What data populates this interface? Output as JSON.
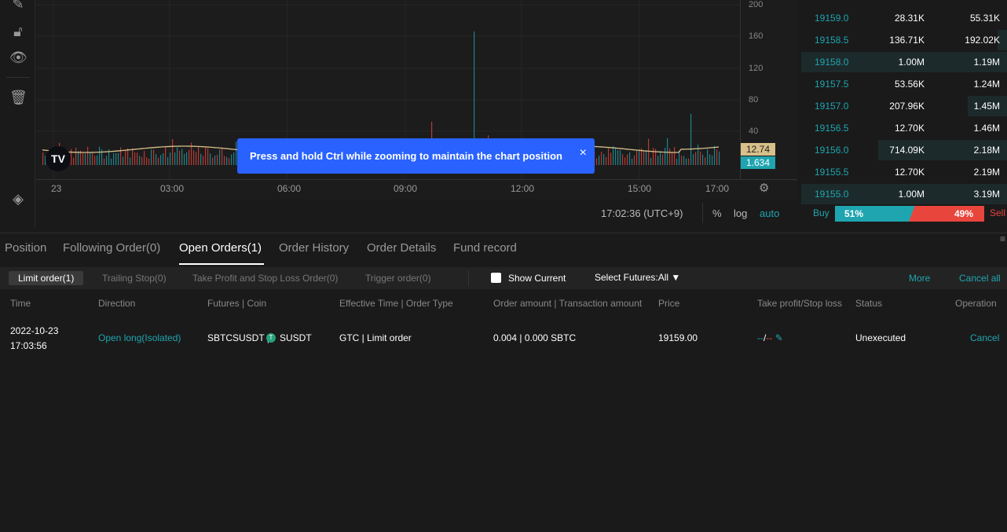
{
  "chart": {
    "price_ticks": [
      "200",
      "160",
      "120",
      "80",
      "40"
    ],
    "time_ticks": [
      "23",
      "03:00",
      "06:00",
      "09:00",
      "12:00",
      "15:00",
      "17:00"
    ],
    "badge_ma": "12.74",
    "badge_vol": "1.634",
    "badge_ma_color": "#d7c08a",
    "badge_vol_color": "#1fa5b0",
    "clock": "17:02:36 (UTC+9)",
    "pct_label": "%",
    "log_label": "log",
    "auto_label": "auto",
    "logo": "TV"
  },
  "toast": {
    "message": "Press and hold Ctrl while zooming to maintain the chart position",
    "close": "×"
  },
  "orderbook": {
    "rows": [
      {
        "price": "19159.0",
        "qty": "28.31K",
        "total": "55.31K"
      },
      {
        "price": "19158.5",
        "qty": "136.71K",
        "total": "192.02K"
      },
      {
        "price": "19158.0",
        "qty": "1.00M",
        "total": "1.19M"
      },
      {
        "price": "19157.5",
        "qty": "53.56K",
        "total": "1.24M"
      },
      {
        "price": "19157.0",
        "qty": "207.96K",
        "total": "1.45M"
      },
      {
        "price": "19156.5",
        "qty": "12.70K",
        "total": "1.46M"
      },
      {
        "price": "19156.0",
        "qty": "714.09K",
        "total": "2.18M"
      },
      {
        "price": "19155.5",
        "qty": "12.70K",
        "total": "2.19M"
      },
      {
        "price": "19155.0",
        "qty": "1.00M",
        "total": "3.19M"
      }
    ],
    "buy_label": "Buy",
    "buy_pct": "51%",
    "sell_pct": "49%",
    "sell_label": "Sell",
    "buy_fraction": 0.51,
    "buy_color": "#1fa5b0",
    "sell_color": "#e8453c"
  },
  "tabs": [
    "Position",
    "Following Order(0)",
    "Open Orders(1)",
    "Order History",
    "Order Details",
    "Fund record"
  ],
  "subtabs": [
    "Limit order(1)",
    "Trailing Stop(0)",
    "Take Profit and Stop Loss Order(0)",
    "Trigger order(0)"
  ],
  "filters": {
    "show_current": "Show Current",
    "select_futures": "Select Futures:All",
    "more": "More",
    "cancel_all": "Cancel all"
  },
  "columns": [
    "Time",
    "Direction",
    "Futures | Coin",
    "Effective Time | Order Type",
    "Order amount | Transaction amount",
    "Price",
    "Take profit/Stop loss",
    "Status",
    "Operation"
  ],
  "order": {
    "date": "2022-10-23",
    "time": "17:03:56",
    "direction": "Open long(Isolated)",
    "futures": "SBTCSUSDT |",
    "coin": "SUSDT",
    "type": "GTC | Limit order",
    "amount": "0.004 | 0.000 SBTC",
    "price": "19159.00",
    "tp": "--",
    "sl": "--",
    "status": "Unexecuted",
    "operation": "Cancel"
  }
}
